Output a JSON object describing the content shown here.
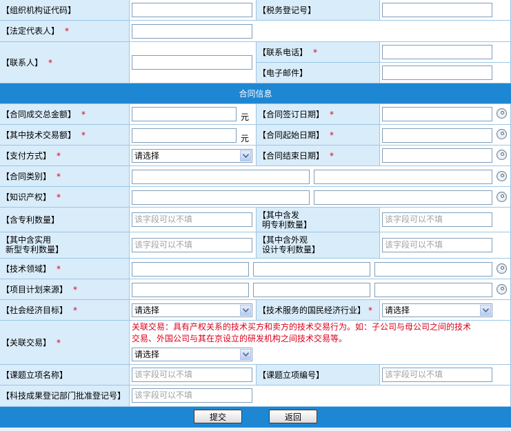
{
  "rows": {
    "org_code": "【组织机构证代码】",
    "tax_reg": "【税务登记号】",
    "legal_rep": "【法定代表人】",
    "contact": "【联系人】",
    "phone": "【联系电话】",
    "email": "【电子邮件】"
  },
  "section_title": "合同信息",
  "contract": {
    "total_amount": "【合同成交总金额】",
    "sign_date": "【合同签订日期】",
    "tech_amount": "【其中技术交易额】",
    "start_date": "【合同起始日期】",
    "payment": "【支付方式】",
    "end_date": "【合同结束日期】",
    "category": "【合同类别】",
    "ip": "【知识产权】",
    "patent_count": "【含专利数量】",
    "invention_patent_1": "【其中含发",
    "invention_patent_2": "明专利数量】",
    "utility_1": "【其中含实用",
    "utility_2": "新型专利数量】",
    "design_1": "【其中含外观",
    "design_2": "设计专利数量】",
    "tech_field": "【技术领域】",
    "project_source": "【项目计划来源】",
    "social_goal": "【社会经济目标】",
    "national_industry": "【技术服务的国民经济行业】",
    "related_trade": "【关联交易】",
    "related_note_1": "关联交易：具有产权关系的技术买方和卖方的技术交易行为。如：子公司与母公司之间的技术",
    "related_note_2": "交易、外国公司与其在京设立的研发机构之间技术交易等。",
    "topic_name": "【课题立项名称】",
    "topic_no": "【课题立项编号】",
    "approval_no": "【科技成果登记部门批准登记号】"
  },
  "required_mark": "*",
  "unit_yuan": "元",
  "optional_placeholder": "该字段可以不填",
  "select_default": "请选择",
  "buttons": {
    "submit": "提交",
    "back": "返回"
  },
  "colors": {
    "label_bg": "#d9ecfa",
    "header_bg": "#1e87d3",
    "required": "#d9001b"
  },
  "icons": {
    "date_picker": "calendar-icon",
    "dropdown": "chevron-down-icon"
  }
}
